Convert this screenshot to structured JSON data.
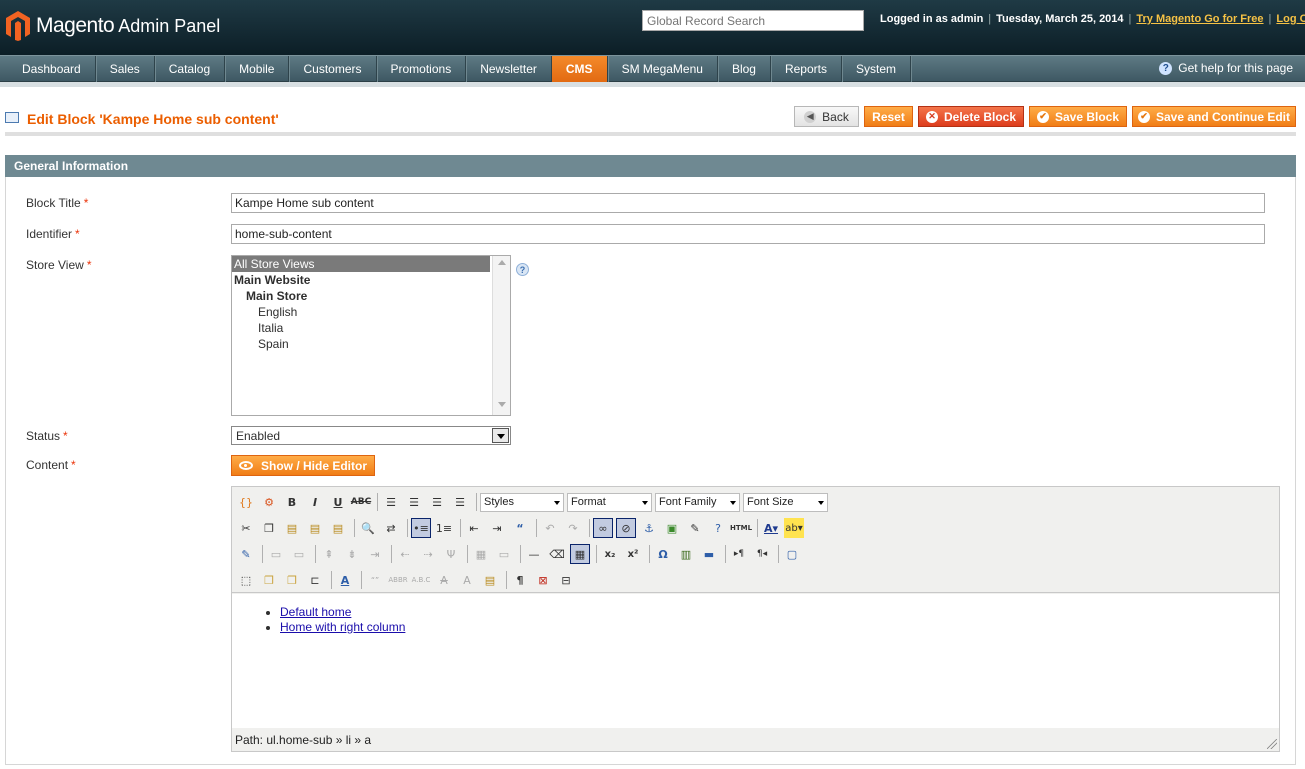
{
  "header": {
    "logo_name": "Magento",
    "logo_suffix": "Admin Panel",
    "search_placeholder": "Global Record Search",
    "logged_in": "Logged in as admin",
    "date": "Tuesday, March 25, 2014",
    "try_link": "Try Magento Go for Free",
    "logout": "Log Out"
  },
  "nav": {
    "items": [
      "Dashboard",
      "Sales",
      "Catalog",
      "Mobile",
      "Customers",
      "Promotions",
      "Newsletter",
      "CMS",
      "SM MegaMenu",
      "Blog",
      "Reports",
      "System"
    ],
    "active": "CMS",
    "help": "Get help for this page"
  },
  "page": {
    "title": "Edit Block 'Kampe Home sub content'",
    "buttons": {
      "back": "Back",
      "reset": "Reset",
      "delete": "Delete Block",
      "save": "Save Block",
      "save_continue": "Save and Continue Edit"
    }
  },
  "section": {
    "title": "General Information"
  },
  "form": {
    "block_title_label": "Block Title",
    "block_title_value": "Kampe Home sub content",
    "identifier_label": "Identifier",
    "identifier_value": "home-sub-content",
    "store_view_label": "Store View",
    "store_views": [
      "All Store Views",
      "Main Website",
      "Main Store",
      "English",
      "Italia",
      "Spain"
    ],
    "status_label": "Status",
    "status_value": "Enabled",
    "content_label": "Content",
    "required_mark": "*",
    "show_hide_editor": "Show / Hide Editor"
  },
  "editor": {
    "selects": [
      "Styles",
      "Format",
      "Font Family",
      "Font Size"
    ],
    "content_links": [
      "Default home",
      "Home with right column"
    ],
    "path": "Path: ul.home-sub » li » a"
  },
  "colors": {
    "accent": "#eb5e00",
    "header_bg": "#0c1e26",
    "nav_bg": "#4e6a74",
    "section_bg": "#6f8992"
  }
}
